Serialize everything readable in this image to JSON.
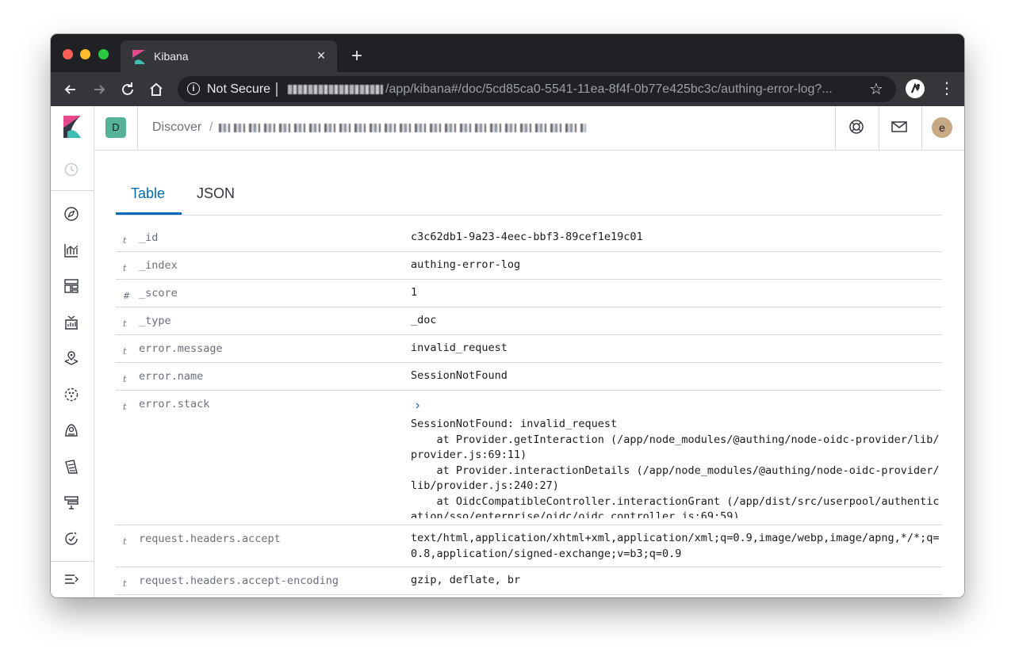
{
  "browser": {
    "tab_title": "Kibana",
    "security_label": "Not Secure",
    "url_visible": "/app/kibana#/doc/5cd85ca0-5541-11ea-8f4f-0b77e425bc3c/authing-error-log?...",
    "close_glyph": "×",
    "newtab_glyph": "+",
    "star_glyph": "☆",
    "menu_glyph": "⋮",
    "info_glyph": "i"
  },
  "header": {
    "space_initial": "D",
    "breadcrumb_root": "Discover",
    "breadcrumb_separator": "/",
    "avatar_initial": "e"
  },
  "sidenav": {
    "icons": [
      "recent-clock-icon",
      "discover-compass-icon",
      "visualize-icon",
      "dashboard-icon",
      "canvas-icon",
      "maps-icon",
      "machine-learning-icon",
      "infrastructure-icon",
      "logs-icon",
      "apm-icon",
      "uptime-icon"
    ],
    "collapse_icon": "collapse-menu-icon"
  },
  "doc_view": {
    "tabs": [
      {
        "label": "Table",
        "active": true
      },
      {
        "label": "JSON",
        "active": false
      }
    ],
    "rows": [
      {
        "type": "t",
        "field": "_id",
        "value": "c3c62db1-9a23-4eec-bbf3-89cef1e19c01"
      },
      {
        "type": "t",
        "field": "_index",
        "value": "authing-error-log"
      },
      {
        "type": "#",
        "field": "_score",
        "value": "1"
      },
      {
        "type": "t",
        "field": "_type",
        "value": "_doc"
      },
      {
        "type": "t",
        "field": "error.message",
        "value": "invalid_request"
      },
      {
        "type": "t",
        "field": "error.name",
        "value": "SessionNotFound"
      },
      {
        "type": "t",
        "field": "error.stack",
        "expand_glyph": "›",
        "value": "SessionNotFound: invalid_request\n    at Provider.getInteraction (/app/node_modules/@authing/node-oidc-provider/lib/provider.js:69:11)\n    at Provider.interactionDetails (/app/node_modules/@authing/node-oidc-provider/lib/provider.js:240:27)\n    at OidcCompatibleController.interactionGrant (/app/dist/src/userpool/authentication/sso/enterprise/oidc/oidc.controller.js:69:59)"
      },
      {
        "type": "t",
        "field": "request.headers.accept",
        "value": "text/html,application/xhtml+xml,application/xml;q=0.9,image/webp,image/apng,*/*;q=0.8,application/signed-exchange;v=b3;q=0.9"
      },
      {
        "type": "t",
        "field": "request.headers.accept-encoding",
        "value": "gzip, deflate, br"
      }
    ]
  },
  "colors": {
    "accent": "#006bb4",
    "space_badge": "#54b399",
    "avatar": "#c8a985",
    "chrome_dark": "#202124",
    "chrome_toolbar": "#35363a"
  }
}
